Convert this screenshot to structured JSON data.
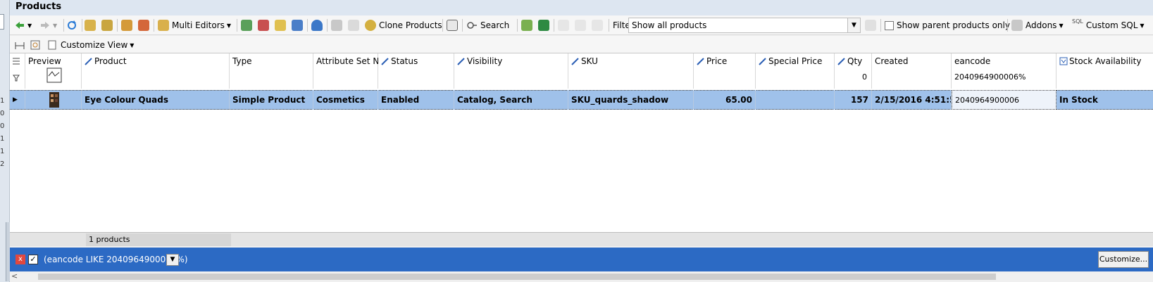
{
  "window": {
    "title": "Products"
  },
  "left_edge": {
    "numbers": [
      "1",
      "0",
      "0",
      "1",
      "1",
      "2"
    ]
  },
  "toolbar": {
    "multi_editors": "Multi Editors",
    "clone_products": "Clone Products",
    "search": "Search",
    "filter_label": "Filter",
    "filter_value": "Show all products",
    "show_parent_only": "Show parent products only",
    "addons": "Addons",
    "sql_badge": "SQL",
    "custom_sql": "Custom SQL"
  },
  "toolbar2": {
    "customize_view": "Customize View"
  },
  "columns": [
    {
      "label": "Preview",
      "filter": ""
    },
    {
      "label": "Product",
      "filter": ""
    },
    {
      "label": "Type",
      "filter": ""
    },
    {
      "label": "Attribute Set N...",
      "filter": ""
    },
    {
      "label": "Status",
      "filter": ""
    },
    {
      "label": "Visibility",
      "filter": ""
    },
    {
      "label": "SKU",
      "filter": ""
    },
    {
      "label": "Price",
      "filter": ""
    },
    {
      "label": "Special Price",
      "filter": ""
    },
    {
      "label": "Qty",
      "filter": "0"
    },
    {
      "label": "Created",
      "filter": ""
    },
    {
      "label": "eancode",
      "filter": "2040964900006%"
    },
    {
      "label": "Stock Availability",
      "filter": ""
    }
  ],
  "row": {
    "product": "Eye Colour Quads",
    "type": "Simple Product",
    "attribute_set": "Cosmetics",
    "status": "Enabled",
    "visibility": "Catalog, Search",
    "sku": "SKU_quards_shadow",
    "price": "65.00",
    "special_price": "",
    "qty": "157",
    "created": "2/15/2016 4:51:5...",
    "eancode": "2040964900006",
    "stock": "In Stock"
  },
  "footer": {
    "count": "1 products"
  },
  "filterbar": {
    "expression": "(eancode LIKE 2040964900006%)",
    "customize": "Customize...",
    "check_glyph": "✓",
    "close_glyph": "x"
  },
  "colors": {
    "accent": "#2c6ac4",
    "selection": "#9fc1ea",
    "title_bg": "#dde6f1"
  }
}
